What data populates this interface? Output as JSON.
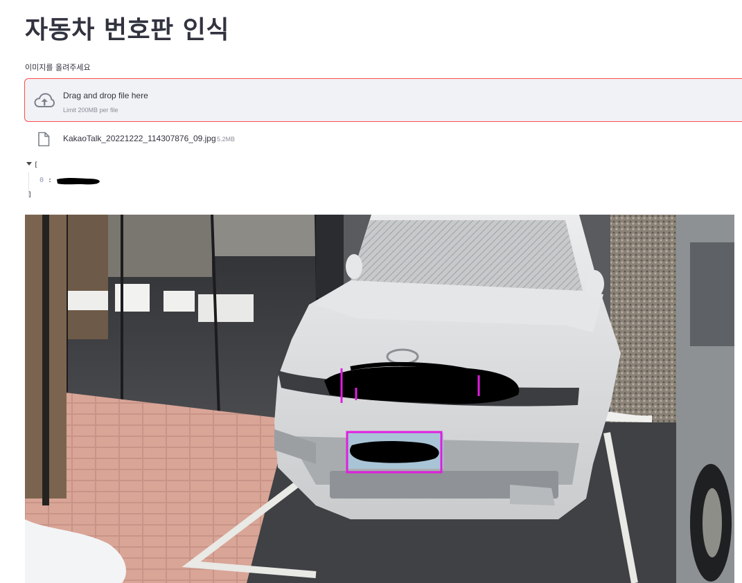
{
  "app": {
    "title": "자동차 번호판 인식"
  },
  "uploader": {
    "label": "이미지를 올려주세요",
    "drop_text": "Drag and drop file here",
    "limit_text": "Limit 200MB per file",
    "icon": "cloud-upload-icon",
    "accent_color": "#ff4b4b"
  },
  "uploaded_file": {
    "name": "KakaoTalk_20221222_114307876_09.jpg",
    "size": "5.2MB",
    "icon": "file-icon"
  },
  "json_output": {
    "open_bracket": "[",
    "index": "0",
    "separator": ":",
    "close_bracket": "]"
  },
  "result_image": {
    "subject": "car-photo",
    "box_color": "#e01ee0"
  }
}
